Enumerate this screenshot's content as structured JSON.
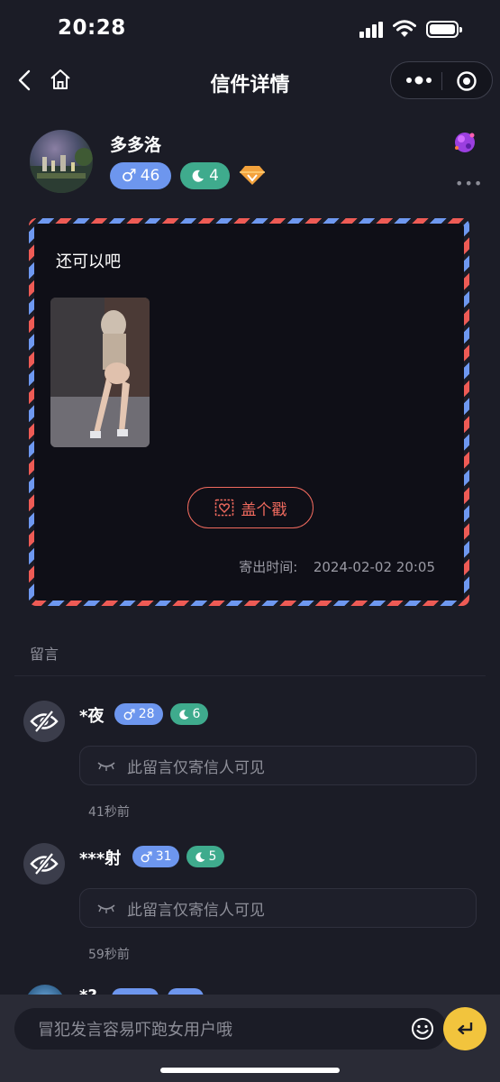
{
  "status_bar": {
    "time": "20:28"
  },
  "nav": {
    "title": "信件详情"
  },
  "sender": {
    "name": "多多洛",
    "gender_symbol": "♂",
    "age": "46",
    "moon_count": "4"
  },
  "letter": {
    "text": "还可以吧",
    "stamp_label": "盖个戳",
    "send_time_label": "寄出时间:",
    "send_time": "2024-02-02 20:05"
  },
  "comments": {
    "section_title": "留言",
    "items": [
      {
        "name": "*夜",
        "gender_symbol": "♂",
        "age": "28",
        "moon_count": "6",
        "hidden_text": "此留言仅寄信人可见",
        "time": "41秒前"
      },
      {
        "name": "***射",
        "gender_symbol": "♂",
        "age": "31",
        "moon_count": "5",
        "hidden_text": "此留言仅寄信人可见",
        "time": "59秒前"
      }
    ],
    "peek": {
      "name": "*?"
    }
  },
  "input_bar": {
    "placeholder": "冒犯发言容易吓跑女用户哦"
  },
  "colors": {
    "background": "#1b1c26",
    "gender_blue": "#6d96ee",
    "moon_green": "#3fab8d",
    "stamp_red": "#ef6a5e",
    "send_yellow": "#f2c43d"
  }
}
